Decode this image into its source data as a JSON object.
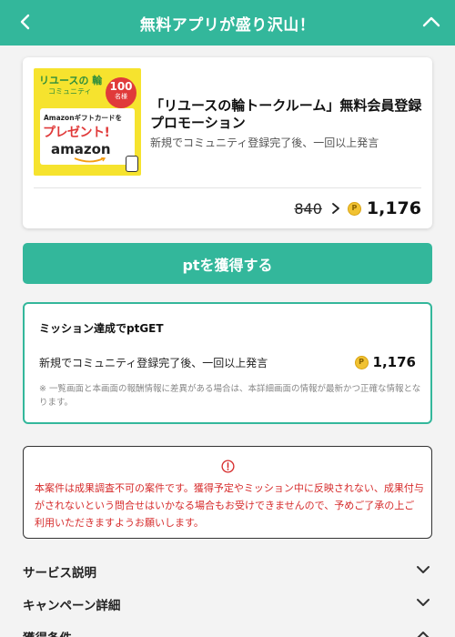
{
  "header": {
    "title": "無料アプリが盛り沢山！",
    "back_icon": "chevron-left-icon",
    "collapse_icon": "chevron-up-icon"
  },
  "offer": {
    "title": "「リユースの輪トークルーム」無料会員登録プロモーション",
    "subtitle": "新規でコミュニティ登録完了後、一回以上発言",
    "old_points": "840",
    "new_points": "1,176",
    "coin_symbol": "P",
    "thumbnail": {
      "line1": "リユースの 輪",
      "line2": "コミュニティ",
      "badge_number": "100",
      "badge_unit": "名様",
      "gift_text": "Amazonギフトカードを",
      "present_text": "プレゼント!",
      "brand": "amazon"
    }
  },
  "cta": {
    "label": "ptを獲得する"
  },
  "mission": {
    "heading": "ミッション達成でptGET",
    "condition": "新規でコミュニティ登録完了後、一回以上発言",
    "points": "1,176",
    "note": "※ 一覧画面と本画面の報酬情報に差異がある場合は、本詳細画面の情報が最新かつ正確な情報となります。"
  },
  "warning": {
    "icon": "alert-circle-icon",
    "text": "本案件は成果調査不可の案件です。獲得予定やミッション中に反映されない、成果付与がされないという問合せはいかなる場合もお受けできませんので、予めご了承の上ご利用いただきますようお願いします。"
  },
  "accordions": [
    {
      "label": "サービス説明",
      "icon": "chevron-down-icon"
    },
    {
      "label": "キャンペーン詳細",
      "icon": "chevron-down-icon"
    },
    {
      "label": "獲得条件",
      "icon": "chevron-up-icon"
    }
  ],
  "colors": {
    "accent": "#33b79b",
    "warning": "#d62b2b",
    "coin": "#f1c232"
  }
}
